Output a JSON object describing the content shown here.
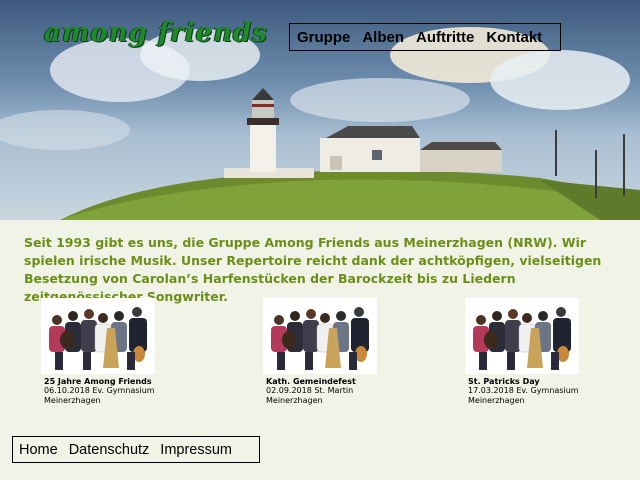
{
  "brand": {
    "logo_text": "among friends"
  },
  "nav": {
    "items": [
      "Gruppe",
      "Alben",
      "Auftritte",
      "Kontakt"
    ]
  },
  "intro": {
    "text": "Seit 1993 gibt es uns, die Gruppe Among Friends aus Meinerzhagen (NRW). Wir spielen irische Musik. Unser Repertoire reicht dank der achtköpfigen, vielseitigen Besetzung von Carolan’s Harfenstücken der Barockzeit bis zu Liedern zeitgenössischer Songwriter."
  },
  "events": [
    {
      "title": "25 Jahre Among Friends",
      "line1": "06.10.2018 Ev. Gymnasium",
      "line2": "Meinerzhagen"
    },
    {
      "title": "Kath. Gemeindefest",
      "line1": "02.09.2018 St. Martin",
      "line2": "Meinerzhagen"
    },
    {
      "title": "St. Patricks Day",
      "line1": "17.03.2018 Ev. Gymnasium",
      "line2": "Meinerzhagen"
    }
  ],
  "footer": {
    "items": [
      "Home",
      "Datenschutz",
      "Impressum"
    ]
  },
  "colors": {
    "accent_text": "#6b8e17",
    "logo_green": "#1f8a2b",
    "page_background": "#f2f3e7"
  }
}
